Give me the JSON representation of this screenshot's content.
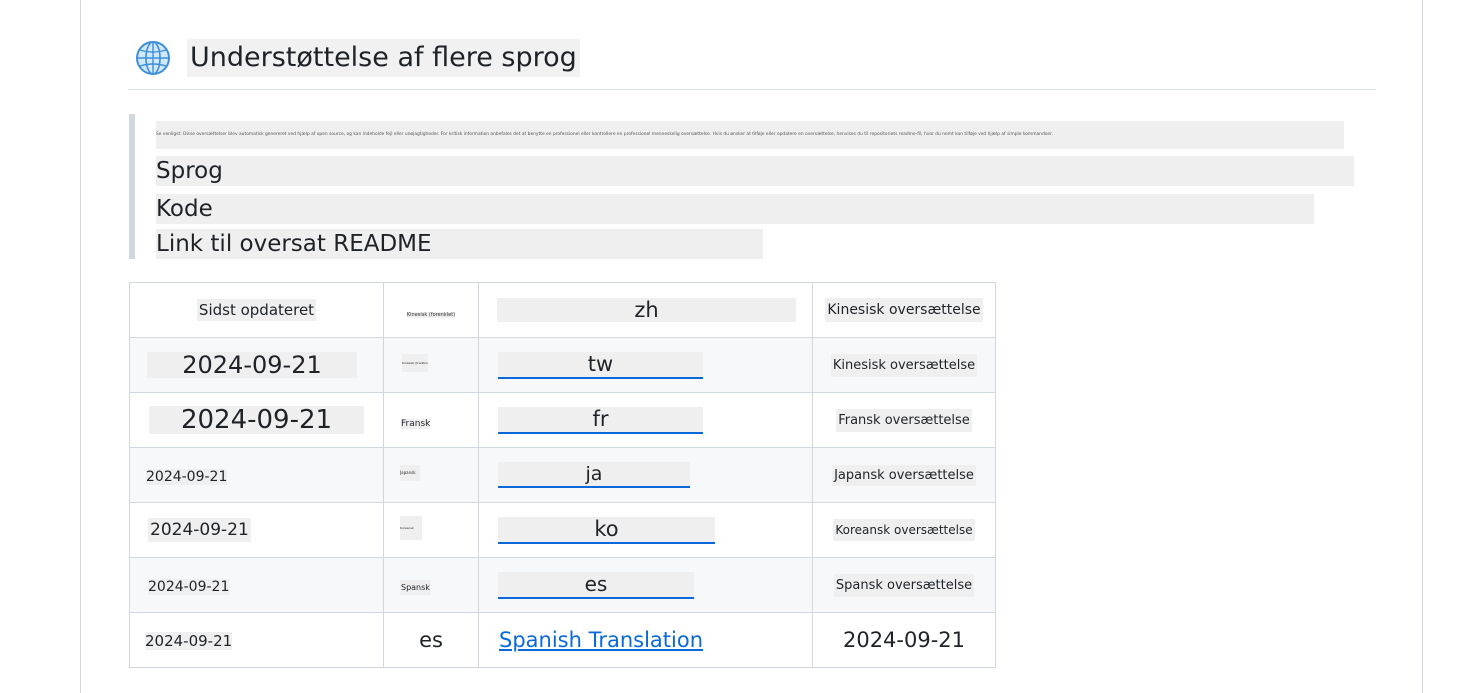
{
  "section": {
    "title": "Understøttelse af flere sprog",
    "icon": "globe-icon"
  },
  "note": {
    "text": "Se venligst: Disse oversættelser blev automatisk genereret ved hjælp af open source, og kan indeholde fejl eller unøjagtigheder. For kritisk information anbefales det at benytte en professionel eller kontrollere en professionel menneskelig oversættelse. Hvis du ønsker at tilføje eller opdatere en oversættelse, henvises du til repositoriets readme-fil, hvor du nemt kan tilføje ved hjælp af simple kommandoer.",
    "lines": [
      "Sprog",
      "Kode",
      "Link til oversat README"
    ]
  },
  "table": {
    "rows": [
      {
        "updated": "Sidst opdateret",
        "lang": "Kinesisk (forenklet)",
        "code": "zh",
        "link": "Kinesisk oversættelse"
      },
      {
        "updated": "2024-09-21",
        "lang": "Kinesisk (traditionel)",
        "code": "tw",
        "link": "Kinesisk oversættelse"
      },
      {
        "updated": "2024-09-21",
        "lang": "Fransk",
        "code": "fr",
        "link": "Fransk oversættelse"
      },
      {
        "updated": "2024-09-21",
        "lang": "Japansk",
        "code": "ja",
        "link": "Japansk oversættelse"
      },
      {
        "updated": "2024-09-21",
        "lang": "Koreansk",
        "code": "ko",
        "link": "Koreansk oversættelse"
      },
      {
        "updated": "2024-09-21",
        "lang": "Spansk",
        "code": "es",
        "link": "Spansk oversættelse"
      },
      {
        "updated": "2024-09-21",
        "lang": "es",
        "code": "Spanish Translation",
        "link": "2024-09-21"
      }
    ]
  }
}
